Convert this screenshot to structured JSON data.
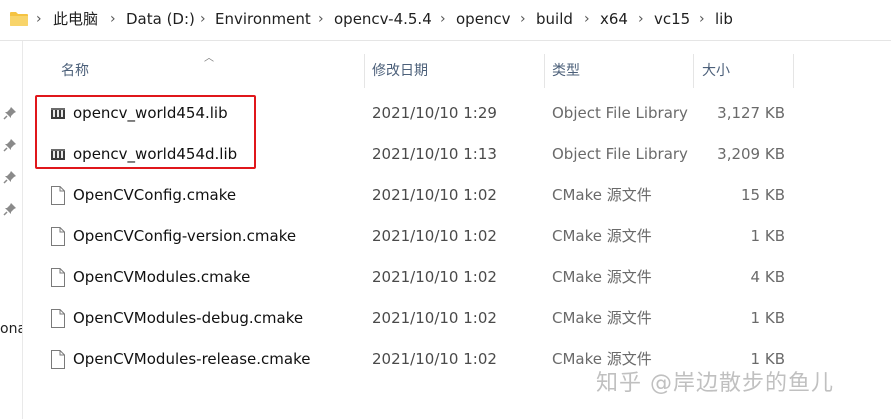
{
  "breadcrumb": {
    "items": [
      "此电脑",
      "Data (D:)",
      "Environment",
      "opencv-4.5.4",
      "opencv",
      "build",
      "x64",
      "vc15",
      "lib"
    ]
  },
  "left_pane": {
    "partial_text": "ona"
  },
  "columns": {
    "name": "名称",
    "date": "修改日期",
    "type": "类型",
    "size": "大小"
  },
  "files": [
    {
      "name": "opencv_world454.lib",
      "date": "2021/10/10 1:29",
      "type": "Object File Library",
      "size": "3,127 KB",
      "icon": "lib-file-icon"
    },
    {
      "name": "opencv_world454d.lib",
      "date": "2021/10/10 1:13",
      "type": "Object File Library",
      "size": "3,209 KB",
      "icon": "lib-file-icon"
    },
    {
      "name": "OpenCVConfig.cmake",
      "date": "2021/10/10 1:02",
      "type": "CMake 源文件",
      "size": "15 KB",
      "icon": "document-icon"
    },
    {
      "name": "OpenCVConfig-version.cmake",
      "date": "2021/10/10 1:02",
      "type": "CMake 源文件",
      "size": "1 KB",
      "icon": "document-icon"
    },
    {
      "name": "OpenCVModules.cmake",
      "date": "2021/10/10 1:02",
      "type": "CMake 源文件",
      "size": "4 KB",
      "icon": "document-icon"
    },
    {
      "name": "OpenCVModules-debug.cmake",
      "date": "2021/10/10 1:02",
      "type": "CMake 源文件",
      "size": "1 KB",
      "icon": "document-icon"
    },
    {
      "name": "OpenCVModules-release.cmake",
      "date": "2021/10/10 1:02",
      "type": "CMake 源文件",
      "size": "1 KB",
      "icon": "document-icon"
    }
  ],
  "watermark": "知乎 @岸边散步的鱼儿",
  "colors": {
    "highlight": "#e0171b",
    "header_text": "#4c607a",
    "folder": "#f5c342"
  }
}
